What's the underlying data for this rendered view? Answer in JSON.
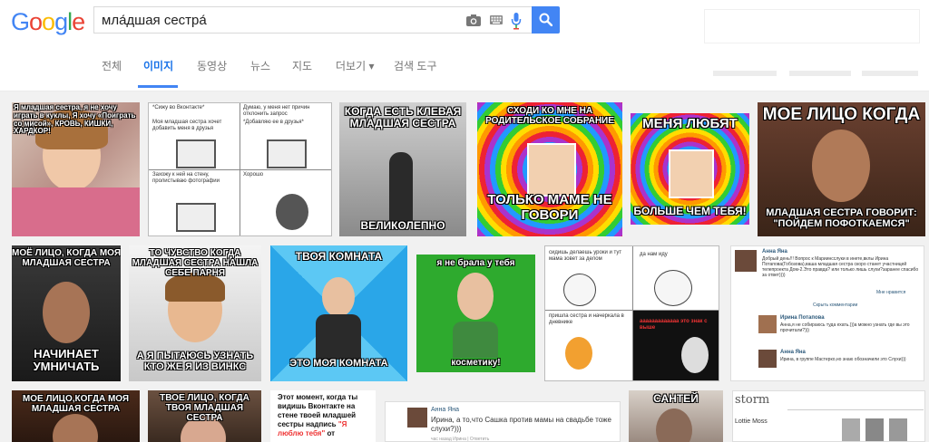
{
  "header": {
    "logo_letters": [
      "G",
      "o",
      "o",
      "g",
      "l",
      "e"
    ],
    "logo_colors": [
      "#4285f4",
      "#ea4335",
      "#fbbc05",
      "#4285f4",
      "#34a853",
      "#ea4335"
    ],
    "search_value": "мла́дшая сестра́",
    "icons": [
      "camera-icon",
      "keyboard-icon",
      "microphone-icon",
      "search-icon"
    ]
  },
  "tabs": [
    {
      "label": "전체"
    },
    {
      "label": "이미지"
    },
    {
      "label": "동영상"
    },
    {
      "label": "뉴스"
    },
    {
      "label": "지도"
    },
    {
      "label": "더보기 ▾"
    },
    {
      "label": "검색 도구"
    }
  ],
  "colors": {
    "accent": "#4285f4",
    "tab_active": "#1a73e8"
  },
  "images": {
    "r1": [
      {
        "text": "Я младшая сестра, я не хочу играть в куклы, Я хочу «Поиграть со мисой», КРОВЬ, КИШКИ, ХАРДКОР!"
      },
      {
        "text_a": "*Сижу во Вконтакте*",
        "text_b": "Моя младшая сестра хочет добавить меня в друзья",
        "text_c": "Думаю, у меня нет причин отклонить запрос",
        "text_d": "*Добавляю ее в друзья*",
        "text_e": "Захожу к ней на стену, пролистываю фотографии",
        "text_f": "Хорошо"
      },
      {
        "top": "КОГДА ЕСТЬ КЛЕВАЯ МЛАДШАЯ СЕСТРА",
        "bottom": "ВЕЛИКОЛЕПНО"
      },
      {
        "top": "СХОДИ КО МНЕ НА РОДИТЕЛЬСКОЕ СОБРАНИЕ",
        "bottom": "ТОЛЬКО МАМЕ НЕ ГОВОРИ"
      },
      {
        "top": "МЕНЯ ЛЮБЯТ",
        "bottom": "БОЛЬШЕ ЧЕМ ТЕБЯ!"
      },
      {
        "top": "МОЕ ЛИЦО КОГДА",
        "bottom": "МЛАДШАЯ СЕСТРА ГОВОРИТ: \"ПОЙДЕМ ПОФОТКАЕМСЯ\""
      }
    ],
    "r2": [
      {
        "top": "МОЁ ЛИЦО, КОГДА МОЯ МЛАДШАЯ СЕСТРА",
        "bottom": "НАЧИНАЕТ УМНИЧАТЬ"
      },
      {
        "top": "ТО ЧУВСТВО КОГДА МЛАДШАЯ СЕСТРА НАШЛА СЕБЕ ПАРНЯ",
        "bottom": "А Я ПЫТАЮСЬ УЗНАТЬ КТО ЖЕ Я ИЗ ВИНКС"
      },
      {
        "top": "ТВОЯ КОМНАТА",
        "bottom": "ЭТО МОЯ КОМНАТА"
      },
      {
        "top": "я не брала у тебя",
        "bottom": "косметику!"
      },
      {
        "text_a": "сидишь делаешь уроки и тут мама зовет за делом",
        "text_b": "да нам иду",
        "text_c": "пришла сестра и начеркала в дневнике",
        "text_d": "ааааааааааааа это знак с выше"
      },
      {
        "name": "Анна Яна",
        "post": "Добрый день!!! Вопрос к Мариинсслуки в инете,вклы Ирина Потапова(Гобозова),ваша младшая сестра скоро станет участницей телепроекта Дом-2.Это правда? или только лишь слухи?заранее спасибо за ответ))))",
        "reply_name": "Ирина Потапова",
        "reply": "Анна,я не собираюсь туда ехать.)))а можно узнать где вы это прочитали?)))",
        "reply2_name": "Анна Яна",
        "reply2": "Ирина, в группе Мастерко,но знаю обозначили это Слухи)))",
        "link": "Скрыть комментарии",
        "likes": "Мне нравится"
      }
    ],
    "r3": [
      {
        "top": "Мое лицо,когда моя младшая сестра"
      },
      {
        "top": "ТВОЕ ЛИЦО, КОГДА ТВОЯ МЛАДШАЯ СЕСТРА"
      },
      {
        "text": "Этот момент, когда ты видишь Вконтакте на стене твоей младшей сестры надпись",
        "highlight": "\"Я люблю тебя\"",
        "tail": "от"
      },
      {
        "name": "Анна Яна",
        "post": "Ирина, а то,что Сашка против мамы на свадьбе тоже слухи?)))",
        "meta": "час назад Ирина | Ответить"
      },
      {
        "top": "САНТЕЙ"
      },
      {
        "brand": "storm",
        "name": "Lottie Moss"
      }
    ]
  }
}
